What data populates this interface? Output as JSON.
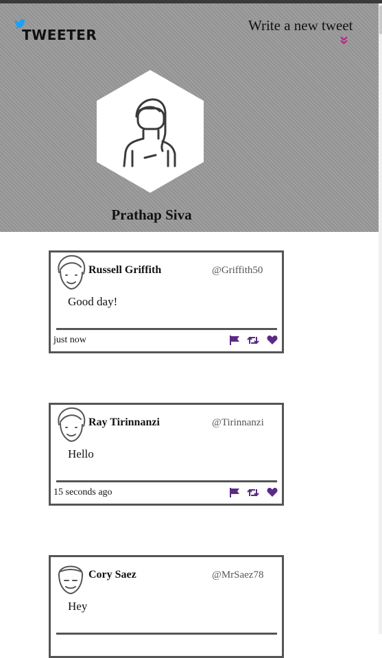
{
  "header": {
    "logo_text": "TWEETER",
    "write_link": "Write a new tweet",
    "profile_name": "Prathap Siva"
  },
  "tweets": [
    {
      "name": "Russell Griffith",
      "handle": "@Griffith50",
      "text": "Good day!",
      "time": "just now"
    },
    {
      "name": "Ray Tirinnanzi",
      "handle": "@Tirinnanzi",
      "text": "Hello",
      "time": "15 seconds ago"
    },
    {
      "name": "Cory Saez",
      "handle": "@MrSaez78",
      "text": "Hey",
      "time": ""
    }
  ],
  "icons": {
    "logo": "bird-icon",
    "write_toggle": "double-chevron-down-icon",
    "flag": "flag-icon",
    "retweet": "retweet-icon",
    "like": "heart-icon"
  },
  "colors": {
    "header_bg": "#9a9a9a",
    "bird": "#1da1f2",
    "chevron": "#c2188b",
    "action_icons": "#5b2a86",
    "tweet_border": "#555555"
  }
}
